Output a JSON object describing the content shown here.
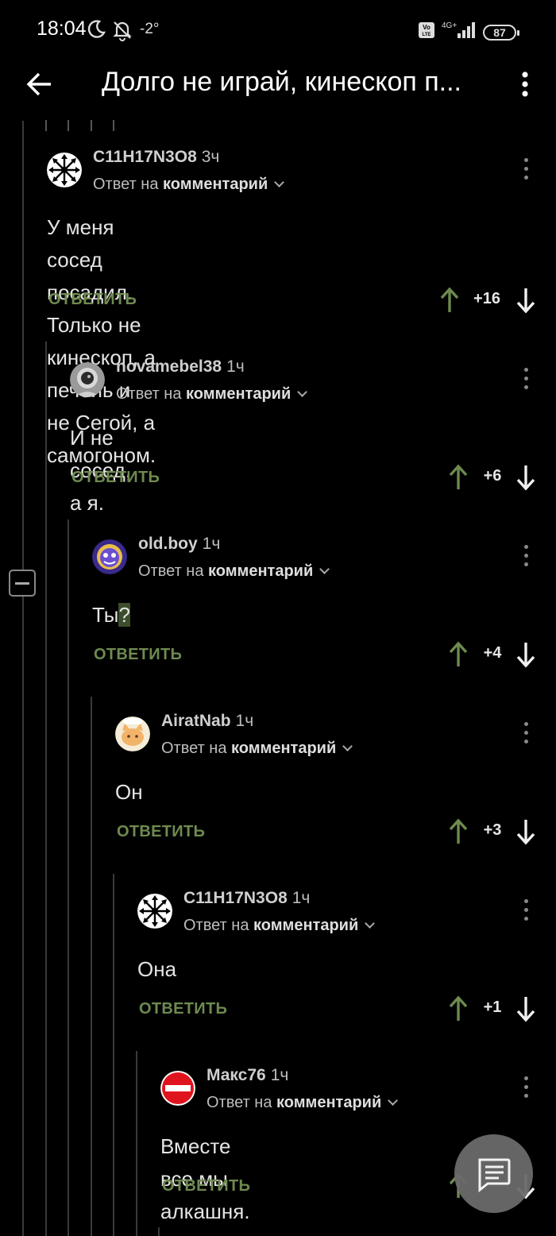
{
  "status_bar": {
    "time": "18:04",
    "temperature": "-2°",
    "network": "4G+",
    "volte": "Vo LTE",
    "battery": "87"
  },
  "header": {
    "title": "Долго не играй, кинескоп п..."
  },
  "labels": {
    "reply_to": "Ответ на",
    "reply_target": "комментарий",
    "reply_button": "ОТВЕТИТЬ"
  },
  "comments": [
    {
      "author": "C11H17N3O8",
      "time": "3ч",
      "text_lines": [
        "У меня сосед посадил. Только не кинескоп, а",
        "печень и не Сегой, а самогоном."
      ],
      "score": "+16",
      "avatar": "radial-arrows-avatar"
    },
    {
      "author": "novamebel38",
      "time": "1ч",
      "text_lines": [
        "И не сосед, а я."
      ],
      "score": "+6",
      "avatar": "astronaut-avatar"
    },
    {
      "author": "old.boy",
      "time": "1ч",
      "text_lines": [
        "Ты",
        "?"
      ],
      "score": "+4",
      "avatar": "purple-face-avatar"
    },
    {
      "author": "AiratNab",
      "time": "1ч",
      "text_lines": [
        "Он"
      ],
      "score": "+3",
      "avatar": "cat-avatar"
    },
    {
      "author": "C11H17N3O8",
      "time": "1ч",
      "text_lines": [
        "Она"
      ],
      "score": "+1",
      "avatar": "radial-arrows-avatar"
    },
    {
      "author": "Макс76",
      "time": "1ч",
      "text_lines": [
        "Вместе все мы алкашня."
      ],
      "score": "",
      "avatar": "no-entry-avatar"
    }
  ],
  "colors": {
    "background": "#000000",
    "accent_green": "#6e8a4f",
    "thread_line": "#3a3a3a",
    "fab": "#6b6b6b"
  }
}
